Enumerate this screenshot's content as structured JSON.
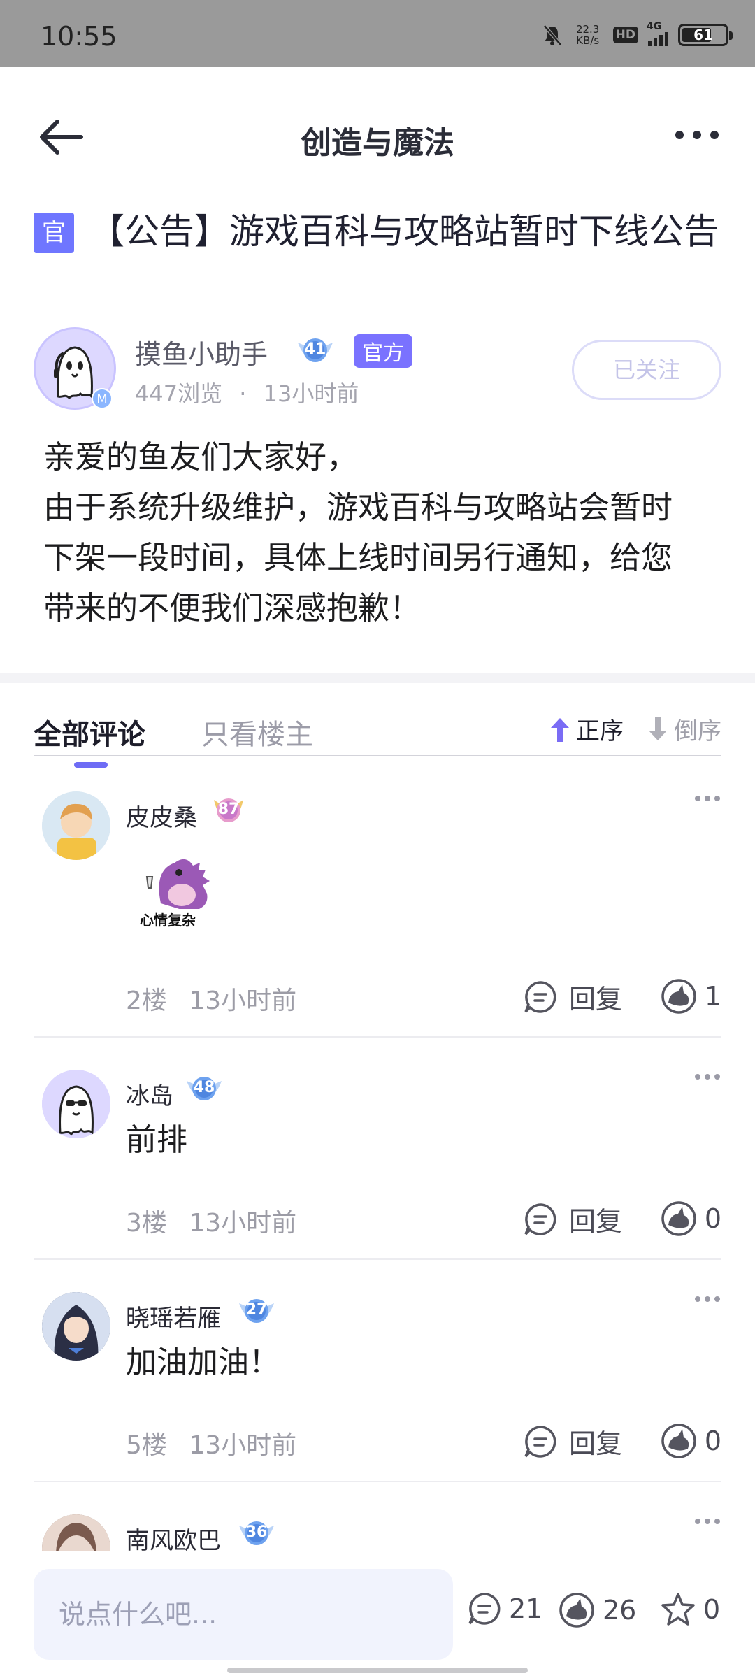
{
  "status_bar": {
    "time": "10:55",
    "net_speed_value": "22.3",
    "net_speed_unit": "KB/s",
    "hd": "HD",
    "network": "4G",
    "battery": "61"
  },
  "header": {
    "title": "创造与魔法",
    "back_icon": "arrow-left-icon",
    "more_icon": "more-horizontal-icon"
  },
  "post": {
    "tag": "官",
    "title": "【公告】游戏百科与攻略站暂时下线公告",
    "author": {
      "name": "摸鱼小助手",
      "level": "41",
      "badge": "官方",
      "views": "447浏览",
      "dot": "·",
      "time": "13小时前",
      "avatar_badge": "M",
      "follow_label": "已关注"
    },
    "body_lines": [
      "亲爱的鱼友们大家好，",
      "由于系统升级维护，游戏百科与攻略站会暂时",
      "下架一段时间，具体上线时间另行通知，给您",
      "带来的不便我们深感抱歉！"
    ]
  },
  "tabs": {
    "all": "全部评论",
    "owner_only": "只看楼主",
    "sort_asc": "正序",
    "sort_desc": "倒序"
  },
  "comments": [
    {
      "name": "皮皮桑",
      "level": "87",
      "sticker_text": "心情复杂",
      "text": "",
      "floor": "2楼",
      "time": "13小时前",
      "reply_label": "回复",
      "likes": "1"
    },
    {
      "name": "冰岛",
      "level": "48",
      "text": "前排",
      "floor": "3楼",
      "time": "13小时前",
      "reply_label": "回复",
      "likes": "0"
    },
    {
      "name": "晓瑶若雁",
      "level": "27",
      "text": "加油加油！",
      "floor": "5楼",
      "time": "13小时前",
      "reply_label": "回复",
      "likes": "0"
    },
    {
      "name": "南风欧巴",
      "level": "36"
    }
  ],
  "bottom_bar": {
    "input_placeholder": "说点什么吧...",
    "comment_count": "21",
    "like_count": "26",
    "star_count": "0"
  },
  "colors": {
    "accent": "#6e6cf5",
    "official_badge": "#7a72ff",
    "tag_bg": "#6f76ff",
    "status_bar_bg": "#9a9a9a"
  }
}
